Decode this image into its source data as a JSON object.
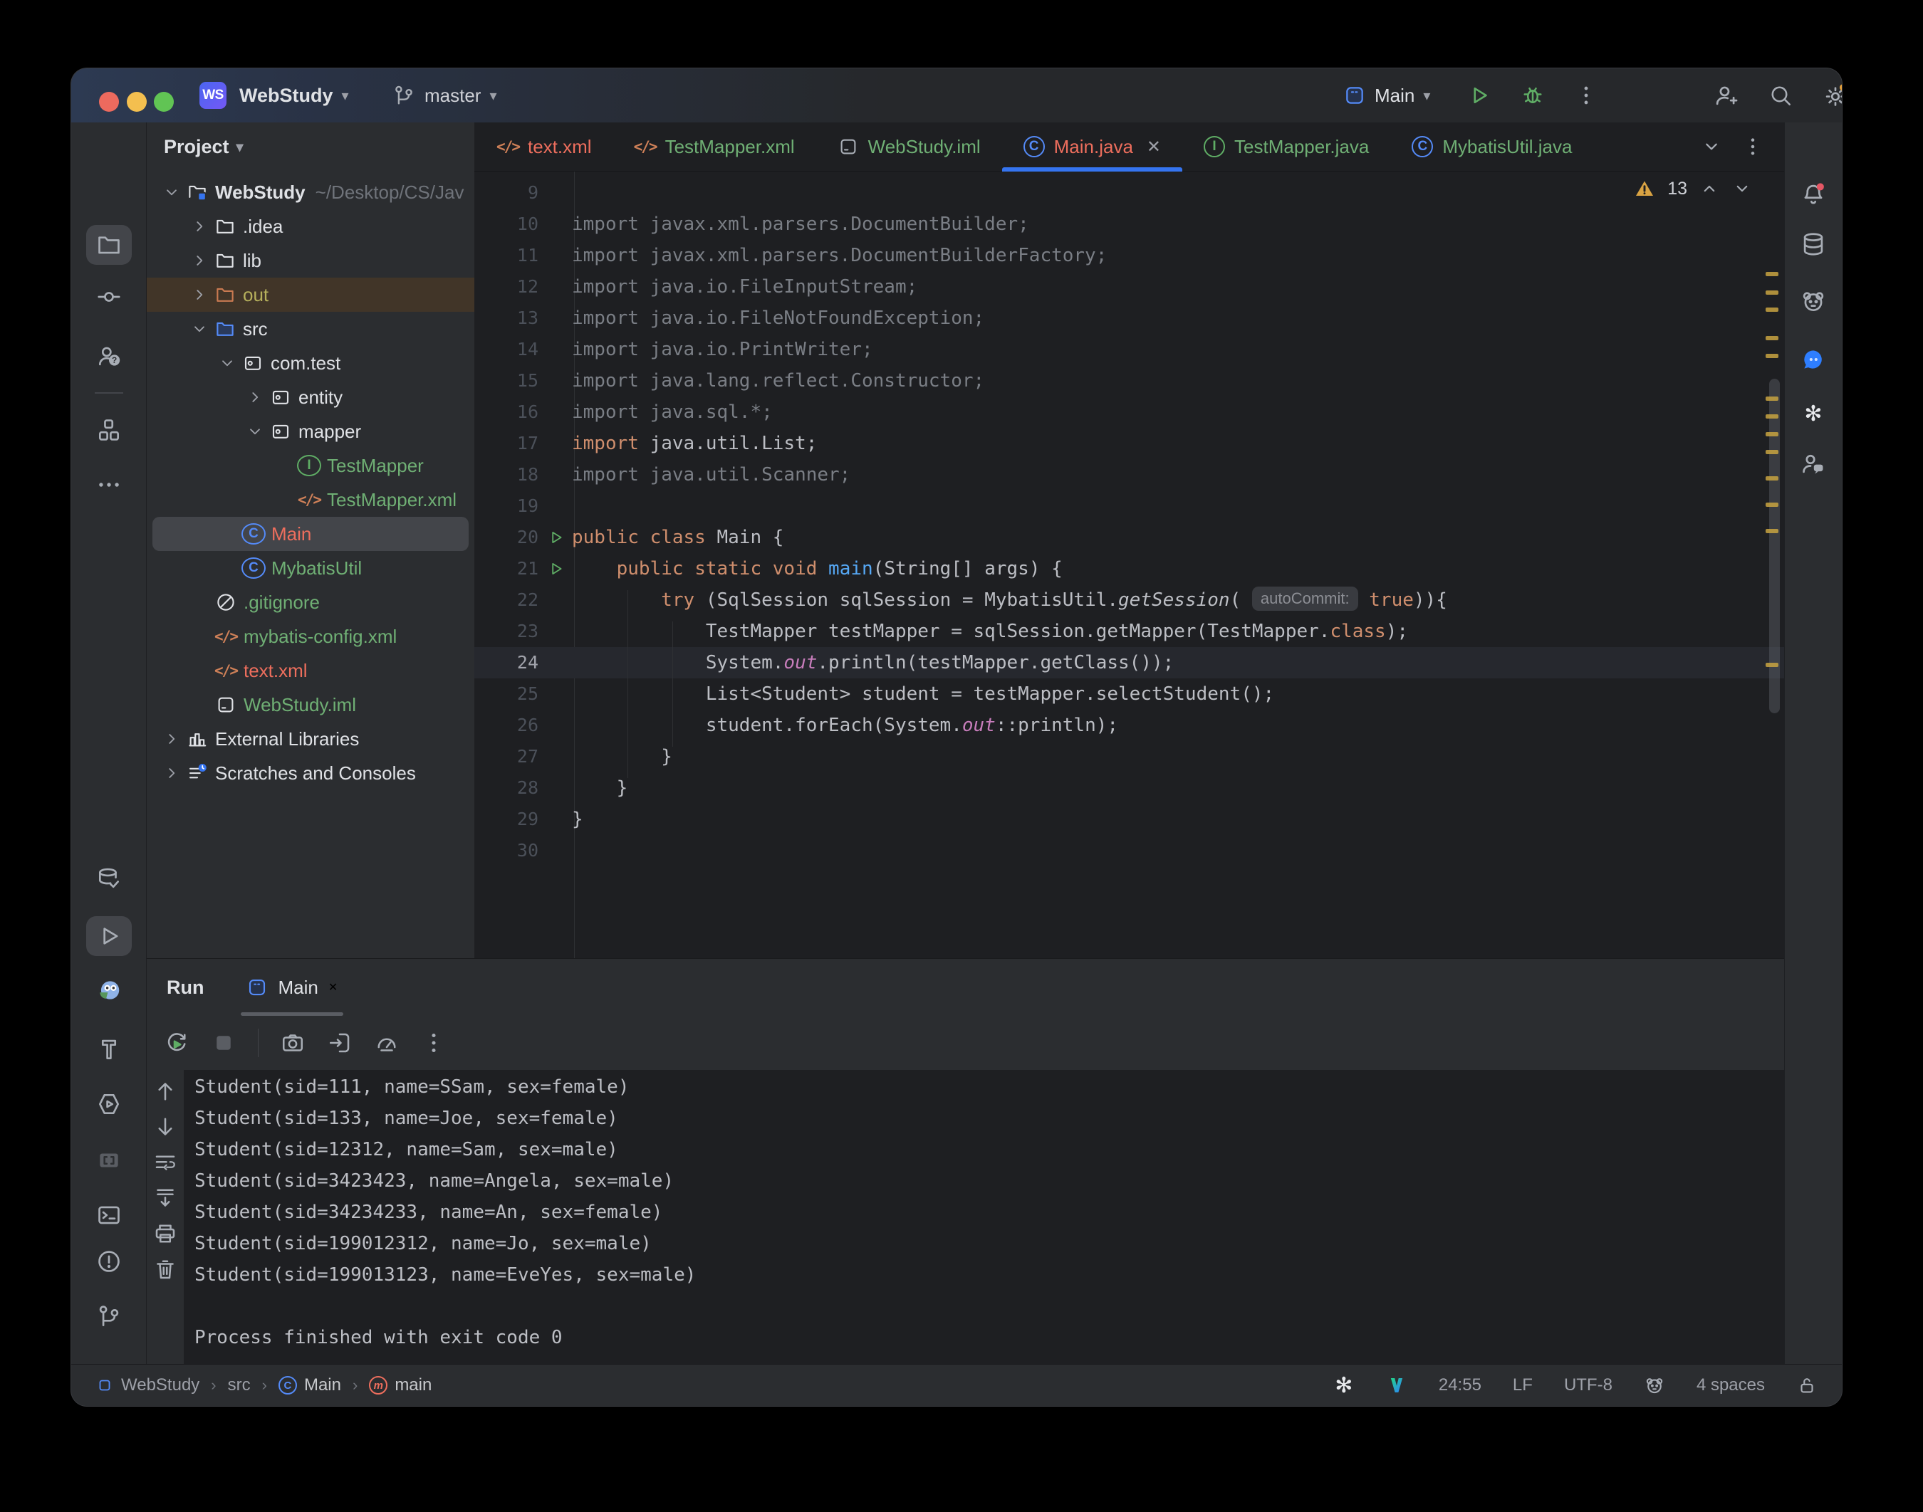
{
  "titlebar": {
    "project_abbrev": "WS",
    "project": "WebStudy",
    "branch": "master",
    "run_config": "Main"
  },
  "tabs_bar": {
    "tabs": [
      {
        "label": "text.xml",
        "icon": "xml",
        "color": "red",
        "active": false
      },
      {
        "label": "TestMapper.xml",
        "icon": "xml",
        "color": "green",
        "active": false
      },
      {
        "label": "WebStudy.iml",
        "icon": "module",
        "color": "green",
        "active": false
      },
      {
        "label": "Main.java",
        "icon": "class",
        "color": "red",
        "active": true,
        "closable": true
      },
      {
        "label": "TestMapper.java",
        "icon": "interface",
        "color": "green",
        "active": false
      },
      {
        "label": "MybatisUtil.java",
        "icon": "class",
        "color": "green",
        "active": false
      }
    ]
  },
  "project_panel": {
    "header": "Project",
    "items": [
      {
        "label": "WebStudy",
        "suffix": "~/Desktop/CS/Jav",
        "depth": 0,
        "icon": "folder-project",
        "chevron": "open",
        "color": "white",
        "bold": true
      },
      {
        "label": ".idea",
        "depth": 1,
        "icon": "folder",
        "chevron": "closed",
        "color": "white"
      },
      {
        "label": "lib",
        "depth": 1,
        "icon": "folder",
        "chevron": "closed",
        "color": "white"
      },
      {
        "label": "out",
        "depth": 1,
        "icon": "folder-orange",
        "chevron": "closed",
        "color": "olive",
        "row": "excluded"
      },
      {
        "label": "src",
        "depth": 1,
        "icon": "folder-src",
        "chevron": "open",
        "color": "white"
      },
      {
        "label": "com.test",
        "depth": 2,
        "icon": "package",
        "chevron": "open",
        "color": "white"
      },
      {
        "label": "entity",
        "depth": 3,
        "icon": "package",
        "chevron": "closed",
        "color": "white"
      },
      {
        "label": "mapper",
        "depth": 3,
        "icon": "package",
        "chevron": "open",
        "color": "white"
      },
      {
        "label": "TestMapper",
        "depth": 5,
        "icon": "interface",
        "color": "green"
      },
      {
        "label": "TestMapper.xml",
        "depth": 5,
        "icon": "xml",
        "color": "green"
      },
      {
        "label": "Main",
        "depth": 3,
        "icon": "class",
        "color": "red",
        "row": "selected"
      },
      {
        "label": "MybatisUtil",
        "depth": 3,
        "icon": "class",
        "color": "green"
      },
      {
        "label": ".gitignore",
        "depth": 2,
        "icon": "ignore",
        "color": "green"
      },
      {
        "label": "mybatis-config.xml",
        "depth": 2,
        "icon": "xml",
        "color": "green"
      },
      {
        "label": "text.xml",
        "depth": 2,
        "icon": "xml",
        "color": "red"
      },
      {
        "label": "WebStudy.iml",
        "depth": 2,
        "icon": "module",
        "color": "green"
      },
      {
        "label": "External Libraries",
        "depth": 0,
        "icon": "extlib",
        "chevron": "closed",
        "color": "white"
      },
      {
        "label": "Scratches and Consoles",
        "depth": 0,
        "icon": "scratch",
        "chevron": "closed",
        "color": "white"
      }
    ]
  },
  "editor": {
    "warning_count": "13",
    "lines": [
      {
        "n": "9",
        "t": []
      },
      {
        "n": "10",
        "t": [
          [
            "g",
            "import javax.xml.parsers.DocumentBuilder;"
          ]
        ]
      },
      {
        "n": "11",
        "t": [
          [
            "g",
            "import javax.xml.parsers.DocumentBuilderFactory;"
          ]
        ]
      },
      {
        "n": "12",
        "t": [
          [
            "g",
            "import java.io.FileInputStream;"
          ]
        ]
      },
      {
        "n": "13",
        "t": [
          [
            "g",
            "import java.io.FileNotFoundException;"
          ]
        ]
      },
      {
        "n": "14",
        "t": [
          [
            "g",
            "import java.io.PrintWriter;"
          ]
        ]
      },
      {
        "n": "15",
        "t": [
          [
            "g",
            "import java.lang.reflect.Constructor;"
          ]
        ]
      },
      {
        "n": "16",
        "t": [
          [
            "g",
            "import java.sql.*;"
          ]
        ]
      },
      {
        "n": "17",
        "t": [
          [
            "k",
            "import"
          ],
          [
            "p",
            " java.util.List;"
          ]
        ]
      },
      {
        "n": "18",
        "t": [
          [
            "g",
            "import java.util.Scanner;"
          ]
        ]
      },
      {
        "n": "19",
        "t": []
      },
      {
        "n": "20",
        "run": true,
        "t": [
          [
            "k",
            "public class"
          ],
          [
            "p",
            " Main {"
          ]
        ]
      },
      {
        "n": "21",
        "run": true,
        "t": [
          [
            "p",
            "    "
          ],
          [
            "k",
            "public static void"
          ],
          [
            "m",
            " main"
          ],
          [
            "p",
            "(String[] args) {"
          ]
        ]
      },
      {
        "n": "22",
        "t": [
          [
            "p",
            "        "
          ],
          [
            "k",
            "try"
          ],
          [
            "p",
            " (SqlSession sqlSession = MybatisUtil."
          ],
          [
            "i",
            "getSession"
          ],
          [
            "p",
            "( "
          ],
          [
            "chip",
            "autoCommit:"
          ],
          [
            "k",
            " true"
          ],
          [
            "p",
            ")){"
          ]
        ]
      },
      {
        "n": "23",
        "t": [
          [
            "p",
            "            TestMapper testMapper = sqlSession.getMapper(TestMapper."
          ],
          [
            "k",
            "class"
          ],
          [
            "p",
            ");"
          ]
        ]
      },
      {
        "n": "24",
        "caret": true,
        "t": [
          [
            "p",
            "            System."
          ],
          [
            "f",
            "out"
          ],
          [
            "p",
            ".println(testMapper.getClass());"
          ]
        ]
      },
      {
        "n": "25",
        "t": [
          [
            "p",
            "            List<Student> student = testMapper.selectStudent();"
          ]
        ]
      },
      {
        "n": "26",
        "t": [
          [
            "p",
            "            student.forEach(System."
          ],
          [
            "f",
            "out"
          ],
          [
            "p",
            "::println);"
          ]
        ]
      },
      {
        "n": "27",
        "t": [
          [
            "p",
            "        }"
          ]
        ]
      },
      {
        "n": "28",
        "t": [
          [
            "p",
            "    }"
          ]
        ]
      },
      {
        "n": "29",
        "t": [
          [
            "p",
            "}"
          ]
        ]
      },
      {
        "n": "30",
        "t": []
      }
    ]
  },
  "run_panel": {
    "title": "Run",
    "tab_label": "Main",
    "console_lines": [
      "Student(sid=111, name=SSam, sex=female)",
      "Student(sid=133, name=Joe, sex=female)",
      "Student(sid=12312, name=Sam, sex=male)",
      "Student(sid=3423423, name=Angela, sex=male)",
      "Student(sid=34234233, name=An, sex=female)",
      "Student(sid=199012312, name=Jo, sex=male)",
      "Student(sid=199013123, name=EveYes, sex=male)",
      "",
      "Process finished with exit code 0"
    ]
  },
  "status_bar": {
    "breadcrumbs": [
      {
        "label": "WebStudy",
        "icon": "bcmodule"
      },
      {
        "label": "src"
      },
      {
        "label": "Main",
        "icon": "class"
      },
      {
        "label": "main",
        "icon": "method"
      }
    ],
    "right_items": [
      {
        "icon": "openai"
      },
      {
        "icon": "vlogo"
      },
      {
        "text": "24:55"
      },
      {
        "text": "LF"
      },
      {
        "text": "UTF-8"
      },
      {
        "icon": "bear"
      },
      {
        "text": "4 spaces"
      },
      {
        "icon": "lock-open"
      }
    ]
  },
  "stripes": {
    "left_top": [
      "folder",
      "commit",
      "user-question",
      "divider",
      "boxes",
      "more-h"
    ],
    "left_bottom": [
      "db-check",
      "play",
      "owl",
      "hammer",
      "hex-play",
      "brackets",
      "terminal",
      "warn-circle",
      "branch"
    ],
    "right": [
      "bell",
      "database",
      "bear",
      "chat",
      "openai",
      "user-chat"
    ]
  },
  "colors": {
    "accent": "#3574F0",
    "warning": "#D9A343",
    "green_file": "#6FAF74",
    "red_file": "#ED6E5D",
    "keyword": "#CF8E6D",
    "method": "#56A8F5",
    "field": "#C77DBB"
  }
}
